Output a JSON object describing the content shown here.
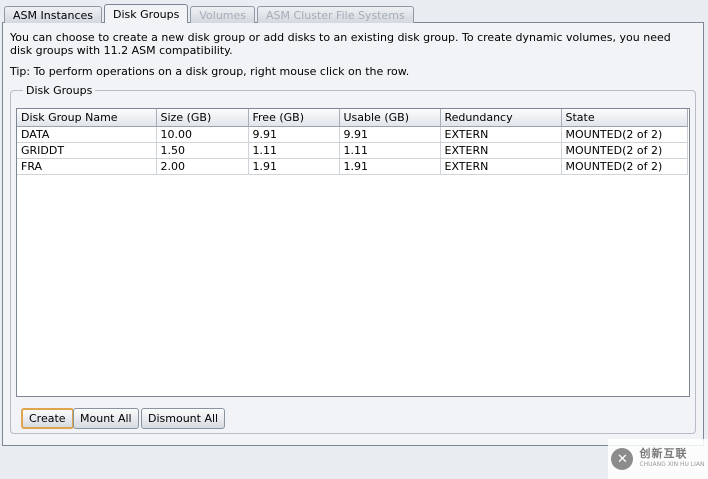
{
  "tabs": [
    {
      "label": "ASM Instances",
      "state": "normal"
    },
    {
      "label": "Disk Groups",
      "state": "active"
    },
    {
      "label": "Volumes",
      "state": "disabled"
    },
    {
      "label": "ASM Cluster File Systems",
      "state": "disabled"
    }
  ],
  "intro_text": "You can choose to create a new disk group or add disks to an existing disk group. To create dynamic volumes, you need disk groups with 11.2 ASM compatibility.",
  "tip_text": "Tip: To perform operations on a disk group, right mouse click on the row.",
  "groupbox_title": "Disk Groups",
  "table": {
    "columns": [
      "Disk Group Name",
      "Size (GB)",
      "Free (GB)",
      "Usable (GB)",
      "Redundancy",
      "State"
    ],
    "rows": [
      [
        "DATA",
        "10.00",
        "9.91",
        "9.91",
        "EXTERN",
        "MOUNTED(2 of 2)"
      ],
      [
        "GRIDDT",
        "1.50",
        "1.11",
        "1.11",
        "EXTERN",
        "MOUNTED(2 of 2)"
      ],
      [
        "FRA",
        "2.00",
        "1.91",
        "1.91",
        "EXTERN",
        "MOUNTED(2 of 2)"
      ]
    ]
  },
  "buttons": {
    "create": "Create",
    "mount_all": "Mount All",
    "dismount_all": "Dismount All"
  },
  "watermark": {
    "icon": "brand-logo-icon",
    "name_cn": "创新互联",
    "name_en": "CHUANG XIN HU LIAN"
  }
}
